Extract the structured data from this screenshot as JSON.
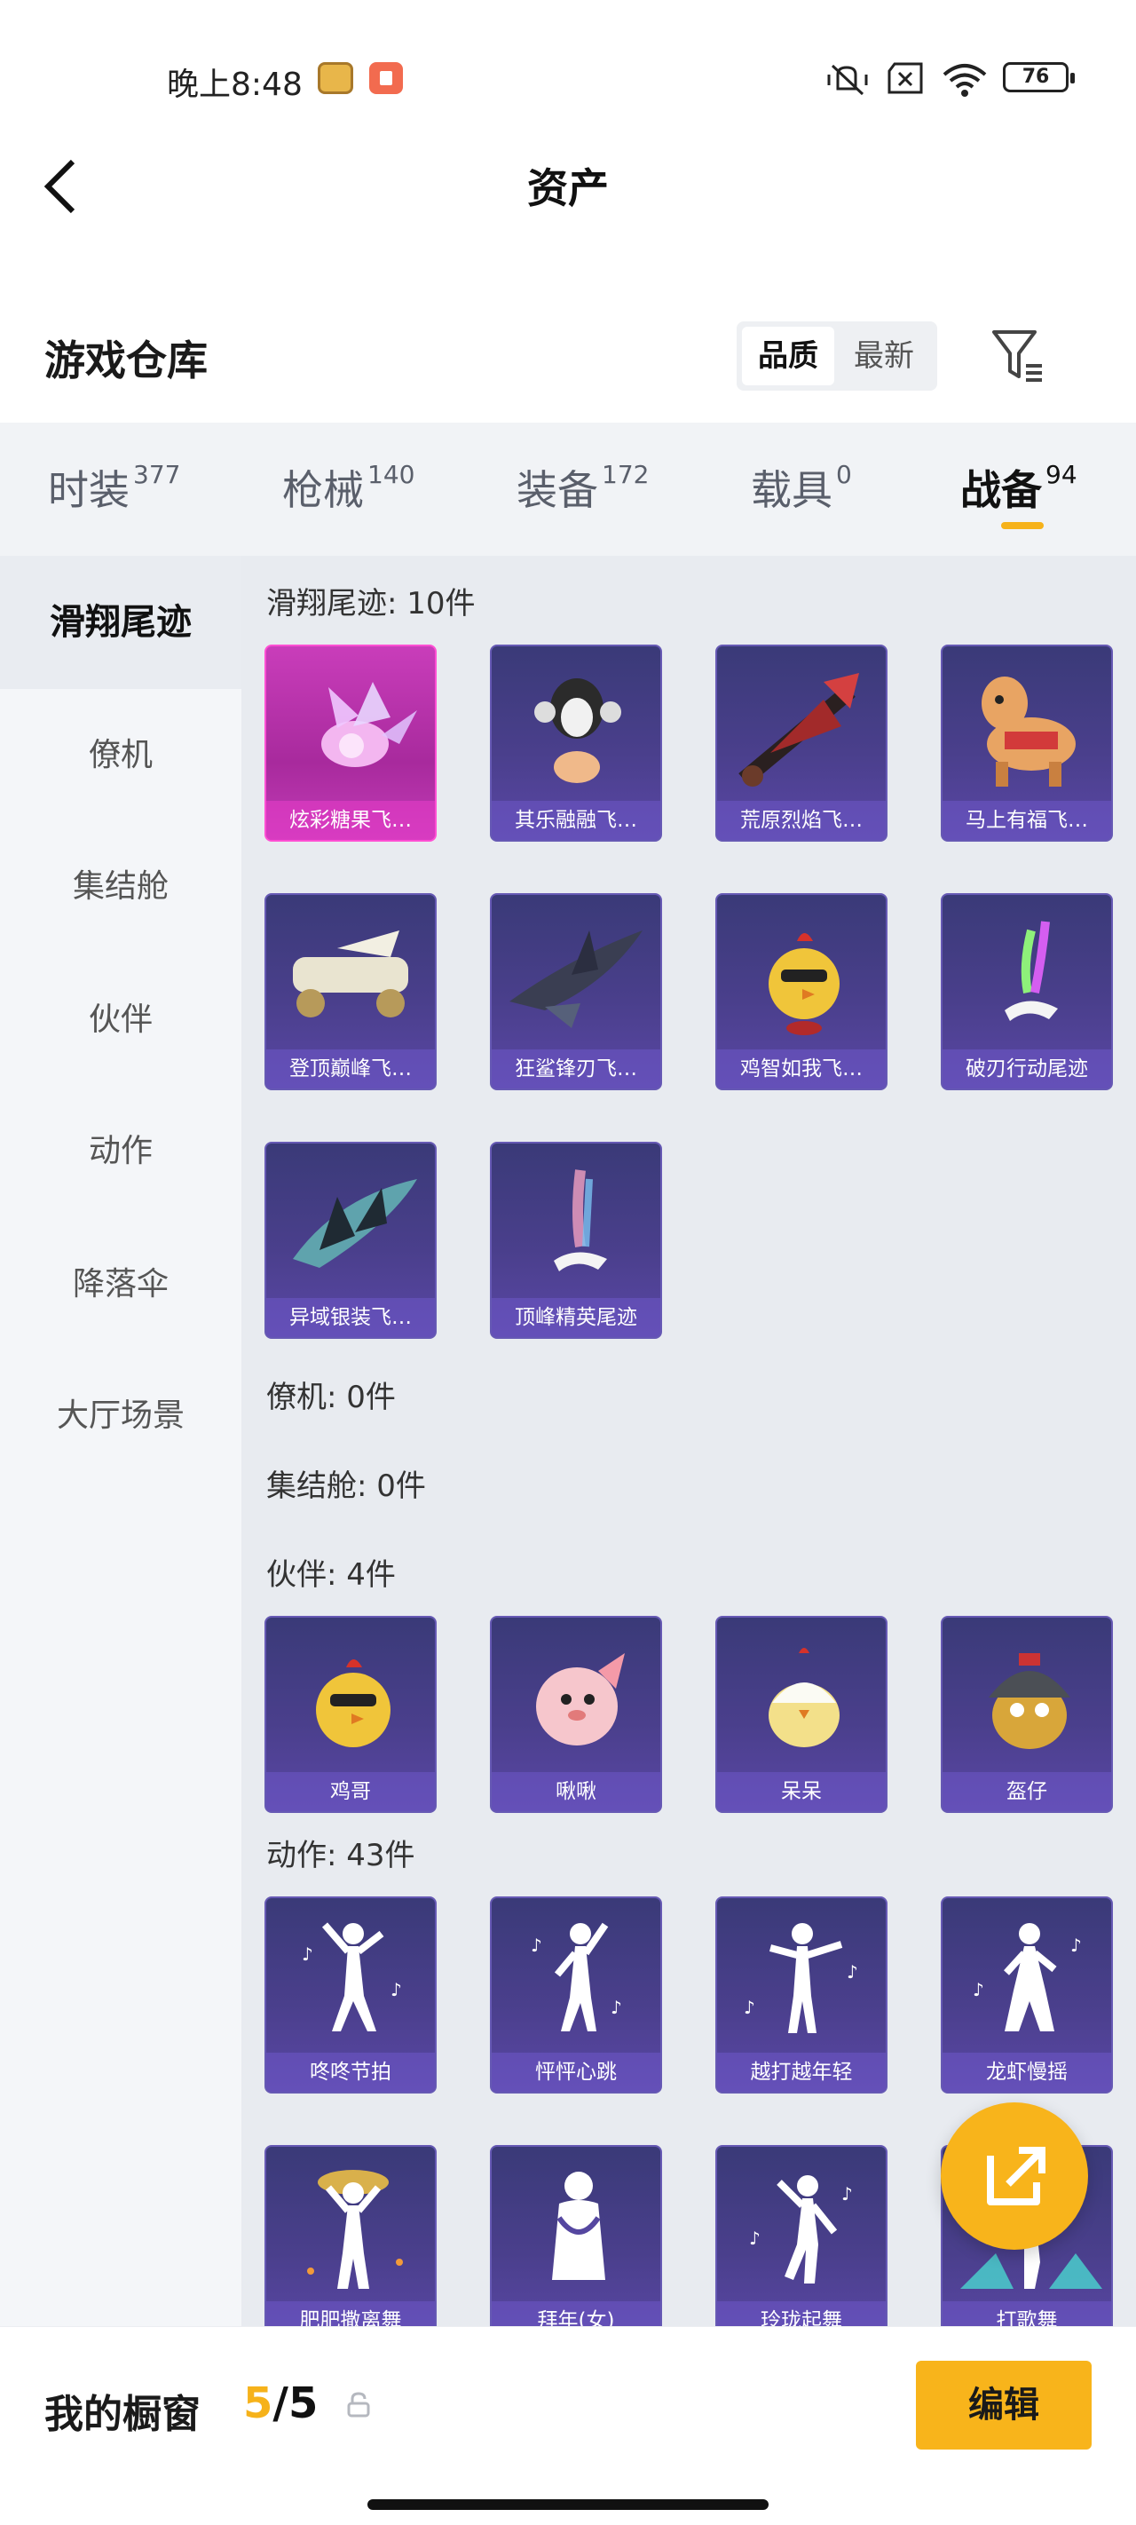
{
  "status_bar": {
    "time": "晚上8:48",
    "battery": "76"
  },
  "header": {
    "title": "资产"
  },
  "warehouse": {
    "title": "游戏仓库",
    "sort_options": [
      "品质",
      "最新"
    ],
    "active_sort": "品质"
  },
  "tabs": [
    {
      "label": "时装",
      "count": "377"
    },
    {
      "label": "枪械",
      "count": "140"
    },
    {
      "label": "装备",
      "count": "172"
    },
    {
      "label": "载具",
      "count": "0"
    },
    {
      "label": "战备",
      "count": "94"
    }
  ],
  "active_tab": "战备",
  "sidebar": {
    "items": [
      "滑翔尾迹",
      "僚机",
      "集结舱",
      "伙伴",
      "动作",
      "降落伞",
      "大厅场景"
    ],
    "active": "滑翔尾迹"
  },
  "sections": [
    {
      "title": "滑翔尾迹: 10件",
      "items": [
        "炫彩糖果飞…",
        "其乐融融飞…",
        "荒原烈焰飞…",
        "马上有福飞…",
        "登顶巅峰飞…",
        "狂鲨锋刃飞…",
        "鸡智如我飞…",
        "破刃行动尾迹",
        "异域银装飞…",
        "顶峰精英尾迹"
      ]
    },
    {
      "title": "僚机: 0件",
      "items": []
    },
    {
      "title": "集结舱: 0件",
      "items": []
    },
    {
      "title": "伙伴: 4件",
      "items": [
        "鸡哥",
        "啾啾",
        "呆呆",
        "盔仔"
      ]
    },
    {
      "title": "动作: 43件",
      "items": [
        "咚咚节拍",
        "怦怦心跳",
        "越打越年轻",
        "龙虾慢摇",
        "肥肥撒离舞",
        "拜年(女)",
        "玲珑起舞",
        "打歌舞"
      ]
    }
  ],
  "bottom": {
    "title": "我的橱窗",
    "current": "5",
    "total": "/5",
    "edit_label": "编辑"
  },
  "colors": {
    "accent": "#f6b21a",
    "card_purple": "#4a3f8c",
    "card_pink": "#c93dba"
  }
}
